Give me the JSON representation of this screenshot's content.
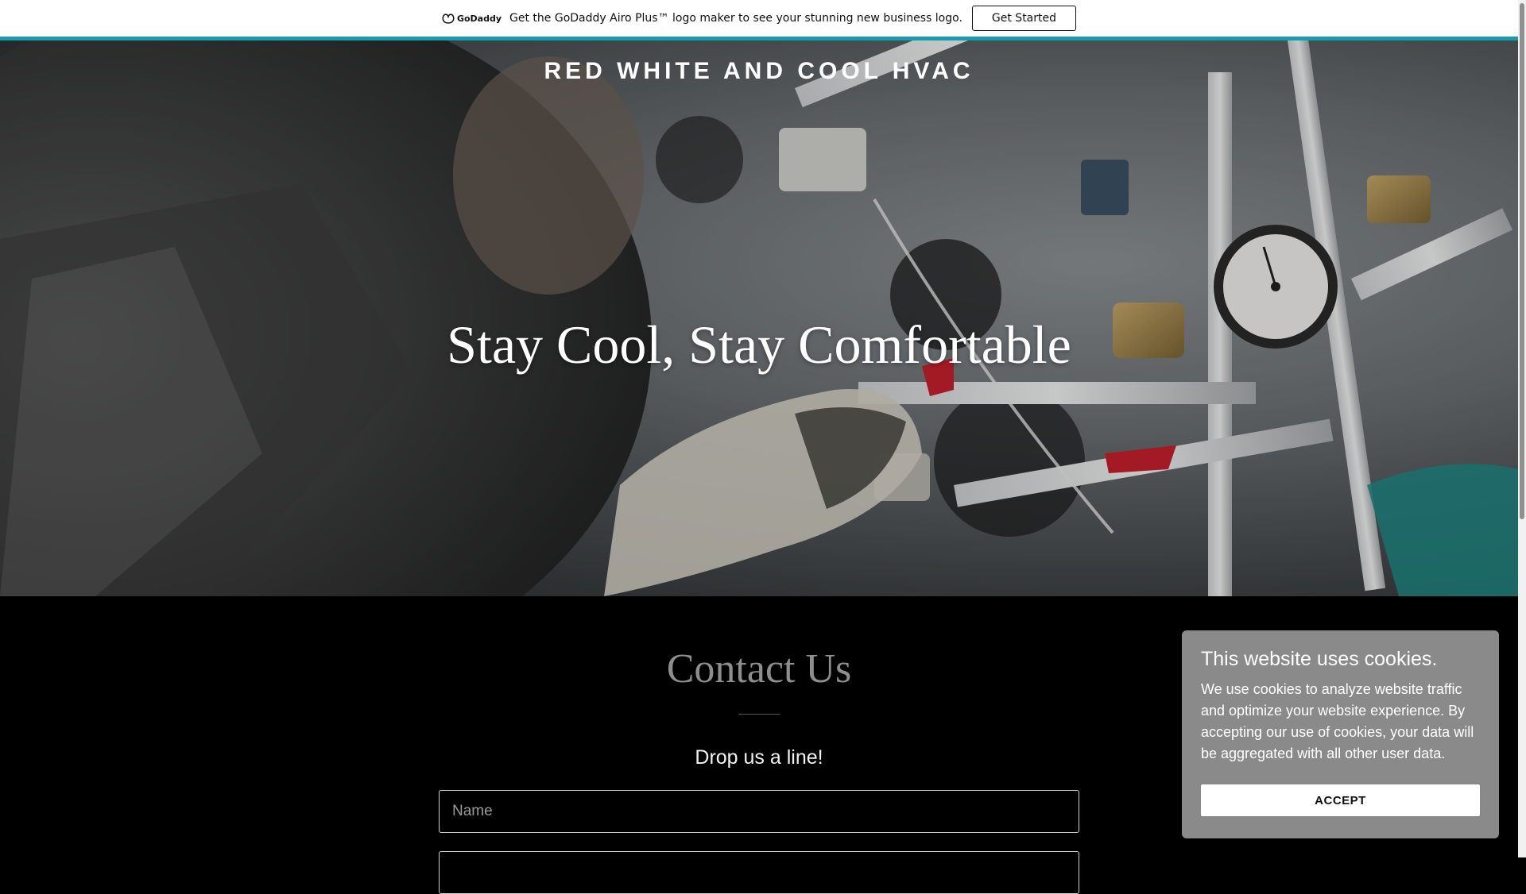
{
  "promo": {
    "brand": "GoDaddy",
    "message": "Get the GoDaddy Airo Plus™ logo maker to see your stunning new business logo.",
    "button_label": "Get Started",
    "accent_color": "#1a9bab"
  },
  "hero": {
    "site_title": "RED WHITE AND COOL HVAC",
    "heading": "Stay Cool, Stay Comfortable"
  },
  "contact": {
    "title": "Contact Us",
    "subtitle": "Drop us a line!",
    "name_placeholder": "Name"
  },
  "cookie": {
    "title": "This website uses cookies.",
    "body": "We use cookies to analyze website traffic and optimize your website experience. By accepting our use of cookies, your data will be aggregated with all other user data.",
    "accept_label": "ACCEPT"
  }
}
